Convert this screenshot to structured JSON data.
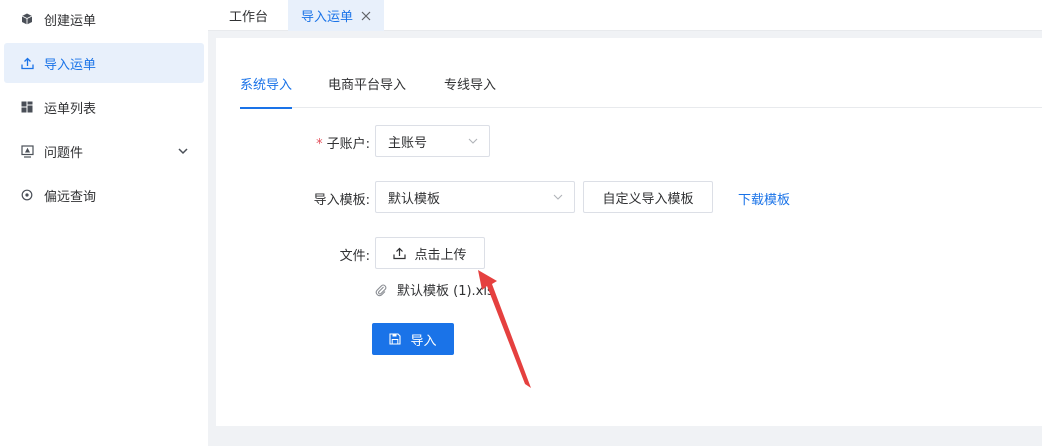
{
  "sidebar": {
    "items": [
      {
        "label": "创建运单",
        "icon": "box-icon"
      },
      {
        "label": "导入运单",
        "icon": "upload-icon",
        "active": true
      },
      {
        "label": "运单列表",
        "icon": "list-grid-icon"
      },
      {
        "label": "问题件",
        "icon": "monitor-warning-icon"
      },
      {
        "label": "偏远查询",
        "icon": "target-icon"
      }
    ]
  },
  "tabs": [
    {
      "label": "工作台"
    },
    {
      "label": "导入运单",
      "active": true
    }
  ],
  "sub_tabs": [
    {
      "label": "系统导入",
      "active": true
    },
    {
      "label": "电商平台导入"
    },
    {
      "label": "专线导入"
    }
  ],
  "form": {
    "sub_account": {
      "label": "子账户:",
      "required_mark": "*",
      "value": "主账号"
    },
    "template": {
      "label": "导入模板:",
      "value": "默认模板",
      "custom_button": "自定义导入模板",
      "download_link": "下载模板"
    },
    "file": {
      "label": "文件:",
      "upload_button": "点击上传",
      "uploaded_file": "默认模板 (1).xls"
    },
    "submit_button": "导入"
  },
  "colors": {
    "accent": "#1a73e8",
    "active_bg": "#e8f0fb",
    "required": "#e34d59",
    "annotation_arrow": "#e5403f"
  }
}
